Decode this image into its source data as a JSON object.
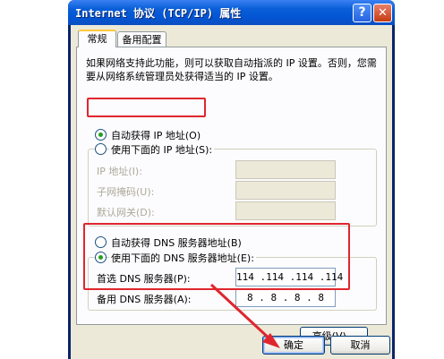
{
  "window": {
    "title": "Internet 协议 (TCP/IP) 属性",
    "help_label": "?",
    "close_label": "✕"
  },
  "tabs": [
    {
      "label": "常规",
      "selected": true
    },
    {
      "label": "备用配置",
      "selected": false
    }
  ],
  "description": "如果网络支持此功能，则可以获取自动指派的 IP 设置。否则，您需要从网络系统管理员处获得适当的 IP 设置。",
  "ip_section": {
    "auto_label": "自动获得 IP 地址(O)",
    "manual_label": "使用下面的 IP 地址(S):",
    "auto_selected": true,
    "fields": [
      {
        "label": "IP 地址(I):",
        "value": ""
      },
      {
        "label": "子网掩码(U):",
        "value": ""
      },
      {
        "label": "默认网关(D):",
        "value": ""
      }
    ]
  },
  "dns_section": {
    "auto_label": "自动获得 DNS 服务器地址(B)",
    "manual_label": "使用下面的 DNS 服务器地址(E):",
    "manual_selected": true,
    "fields": [
      {
        "label": "首选 DNS 服务器(P):",
        "value": "114 .114 .114 .114"
      },
      {
        "label": "备用 DNS 服务器(A):",
        "value": "8  .  8  .  8  .  8"
      }
    ]
  },
  "buttons": {
    "advanced": "高级(V)...",
    "ok": "确定",
    "cancel": "取消"
  },
  "colors": {
    "highlight": "#e0262d",
    "arrow": "#e0262d",
    "titlebar": "#0355d3"
  }
}
